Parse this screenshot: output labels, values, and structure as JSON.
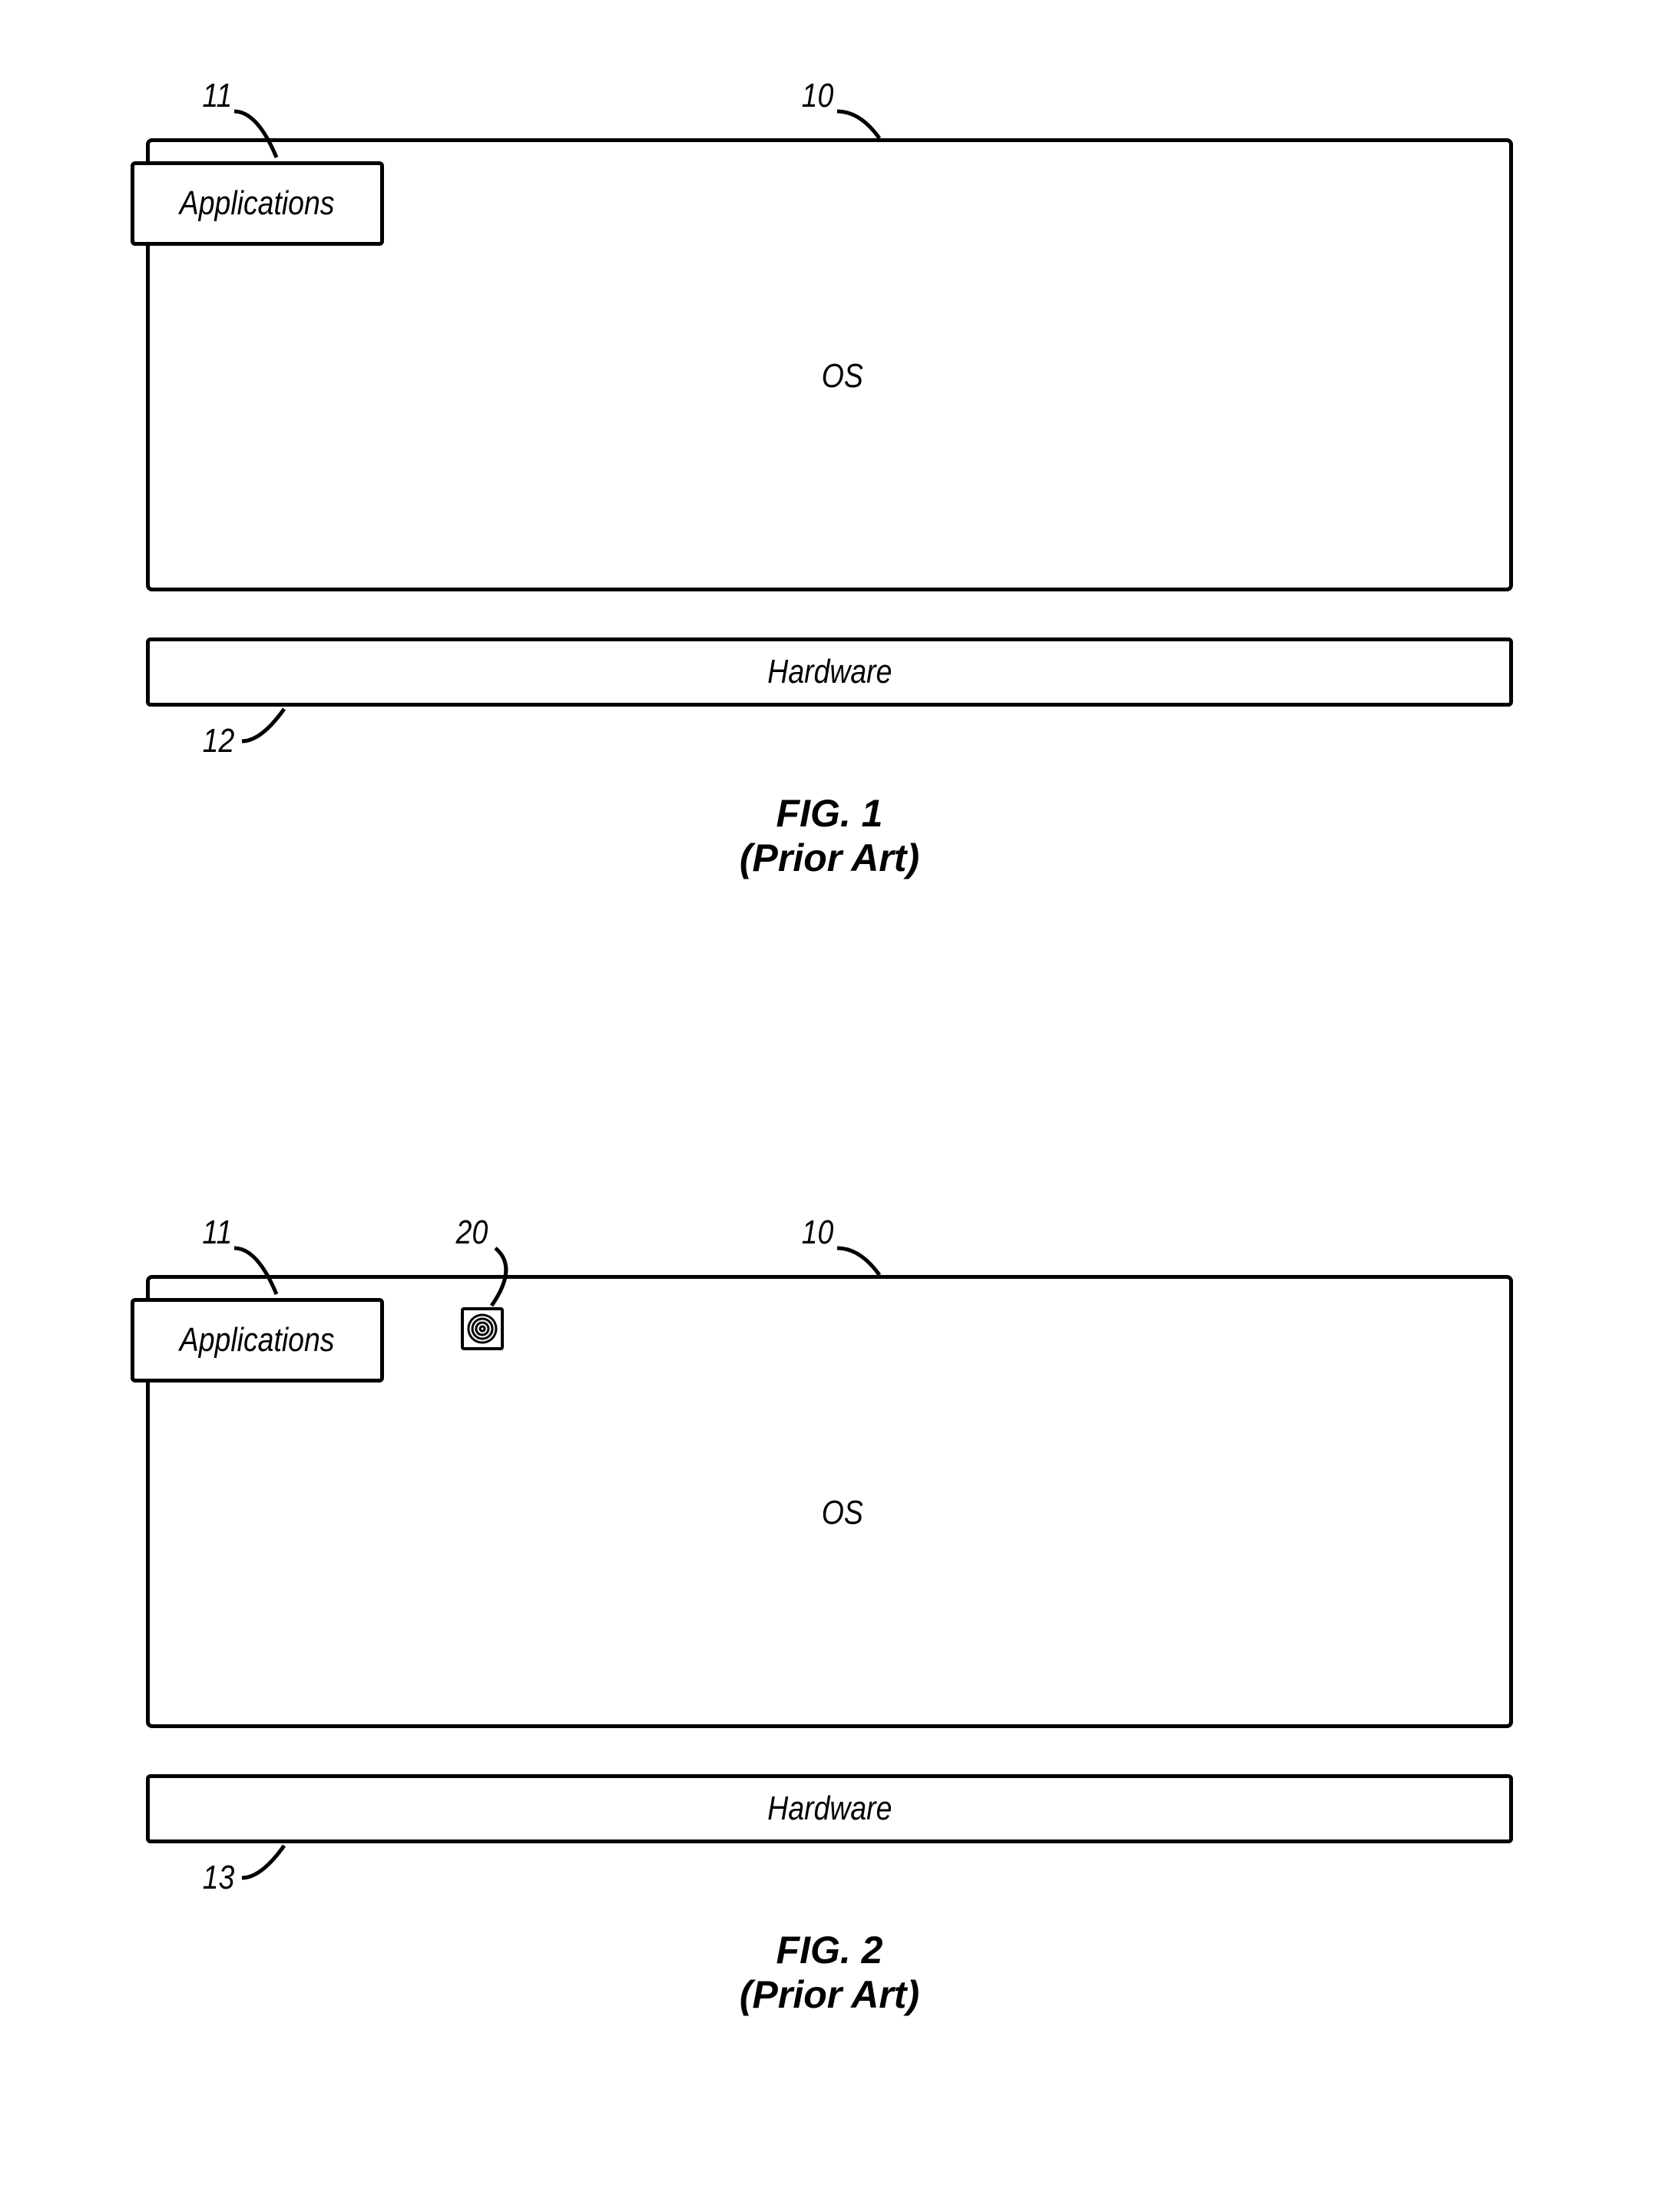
{
  "fig1": {
    "refs": {
      "apps": "11",
      "os": "10",
      "hw": "12"
    },
    "labels": {
      "apps": "Applications",
      "os": "OS",
      "hw": "Hardware"
    },
    "caption_line1": "FIG. 1",
    "caption_line2": "(Prior Art)"
  },
  "fig2": {
    "refs": {
      "apps": "11",
      "agent": "20",
      "os": "10",
      "hw": "13"
    },
    "labels": {
      "apps": "Applications",
      "os": "OS",
      "hw": "Hardware"
    },
    "caption_line1": "FIG. 2",
    "caption_line2": "(Prior Art)"
  }
}
